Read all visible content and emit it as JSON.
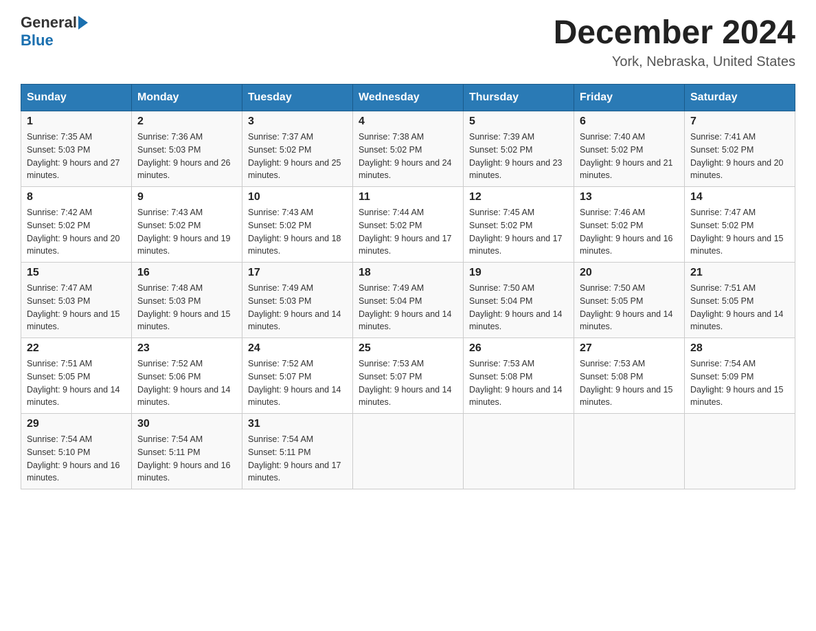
{
  "header": {
    "logo_general": "General",
    "logo_blue": "Blue",
    "month_year": "December 2024",
    "location": "York, Nebraska, United States"
  },
  "days_of_week": [
    "Sunday",
    "Monday",
    "Tuesday",
    "Wednesday",
    "Thursday",
    "Friday",
    "Saturday"
  ],
  "weeks": [
    [
      {
        "day": "1",
        "sunrise": "7:35 AM",
        "sunset": "5:03 PM",
        "daylight": "9 hours and 27 minutes."
      },
      {
        "day": "2",
        "sunrise": "7:36 AM",
        "sunset": "5:03 PM",
        "daylight": "9 hours and 26 minutes."
      },
      {
        "day": "3",
        "sunrise": "7:37 AM",
        "sunset": "5:02 PM",
        "daylight": "9 hours and 25 minutes."
      },
      {
        "day": "4",
        "sunrise": "7:38 AM",
        "sunset": "5:02 PM",
        "daylight": "9 hours and 24 minutes."
      },
      {
        "day": "5",
        "sunrise": "7:39 AM",
        "sunset": "5:02 PM",
        "daylight": "9 hours and 23 minutes."
      },
      {
        "day": "6",
        "sunrise": "7:40 AM",
        "sunset": "5:02 PM",
        "daylight": "9 hours and 21 minutes."
      },
      {
        "day": "7",
        "sunrise": "7:41 AM",
        "sunset": "5:02 PM",
        "daylight": "9 hours and 20 minutes."
      }
    ],
    [
      {
        "day": "8",
        "sunrise": "7:42 AM",
        "sunset": "5:02 PM",
        "daylight": "9 hours and 20 minutes."
      },
      {
        "day": "9",
        "sunrise": "7:43 AM",
        "sunset": "5:02 PM",
        "daylight": "9 hours and 19 minutes."
      },
      {
        "day": "10",
        "sunrise": "7:43 AM",
        "sunset": "5:02 PM",
        "daylight": "9 hours and 18 minutes."
      },
      {
        "day": "11",
        "sunrise": "7:44 AM",
        "sunset": "5:02 PM",
        "daylight": "9 hours and 17 minutes."
      },
      {
        "day": "12",
        "sunrise": "7:45 AM",
        "sunset": "5:02 PM",
        "daylight": "9 hours and 17 minutes."
      },
      {
        "day": "13",
        "sunrise": "7:46 AM",
        "sunset": "5:02 PM",
        "daylight": "9 hours and 16 minutes."
      },
      {
        "day": "14",
        "sunrise": "7:47 AM",
        "sunset": "5:02 PM",
        "daylight": "9 hours and 15 minutes."
      }
    ],
    [
      {
        "day": "15",
        "sunrise": "7:47 AM",
        "sunset": "5:03 PM",
        "daylight": "9 hours and 15 minutes."
      },
      {
        "day": "16",
        "sunrise": "7:48 AM",
        "sunset": "5:03 PM",
        "daylight": "9 hours and 15 minutes."
      },
      {
        "day": "17",
        "sunrise": "7:49 AM",
        "sunset": "5:03 PM",
        "daylight": "9 hours and 14 minutes."
      },
      {
        "day": "18",
        "sunrise": "7:49 AM",
        "sunset": "5:04 PM",
        "daylight": "9 hours and 14 minutes."
      },
      {
        "day": "19",
        "sunrise": "7:50 AM",
        "sunset": "5:04 PM",
        "daylight": "9 hours and 14 minutes."
      },
      {
        "day": "20",
        "sunrise": "7:50 AM",
        "sunset": "5:05 PM",
        "daylight": "9 hours and 14 minutes."
      },
      {
        "day": "21",
        "sunrise": "7:51 AM",
        "sunset": "5:05 PM",
        "daylight": "9 hours and 14 minutes."
      }
    ],
    [
      {
        "day": "22",
        "sunrise": "7:51 AM",
        "sunset": "5:05 PM",
        "daylight": "9 hours and 14 minutes."
      },
      {
        "day": "23",
        "sunrise": "7:52 AM",
        "sunset": "5:06 PM",
        "daylight": "9 hours and 14 minutes."
      },
      {
        "day": "24",
        "sunrise": "7:52 AM",
        "sunset": "5:07 PM",
        "daylight": "9 hours and 14 minutes."
      },
      {
        "day": "25",
        "sunrise": "7:53 AM",
        "sunset": "5:07 PM",
        "daylight": "9 hours and 14 minutes."
      },
      {
        "day": "26",
        "sunrise": "7:53 AM",
        "sunset": "5:08 PM",
        "daylight": "9 hours and 14 minutes."
      },
      {
        "day": "27",
        "sunrise": "7:53 AM",
        "sunset": "5:08 PM",
        "daylight": "9 hours and 15 minutes."
      },
      {
        "day": "28",
        "sunrise": "7:54 AM",
        "sunset": "5:09 PM",
        "daylight": "9 hours and 15 minutes."
      }
    ],
    [
      {
        "day": "29",
        "sunrise": "7:54 AM",
        "sunset": "5:10 PM",
        "daylight": "9 hours and 16 minutes."
      },
      {
        "day": "30",
        "sunrise": "7:54 AM",
        "sunset": "5:11 PM",
        "daylight": "9 hours and 16 minutes."
      },
      {
        "day": "31",
        "sunrise": "7:54 AM",
        "sunset": "5:11 PM",
        "daylight": "9 hours and 17 minutes."
      },
      null,
      null,
      null,
      null
    ]
  ]
}
